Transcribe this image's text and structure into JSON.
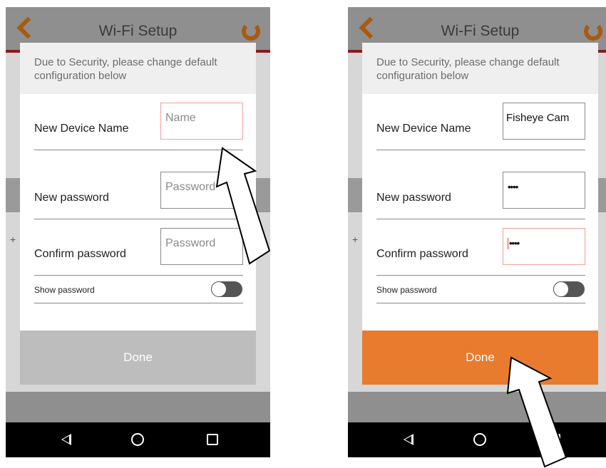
{
  "colors": {
    "accent_orange": "#e87b2e",
    "done_disabled": "#bdbdbd",
    "focus_border": "#f3a09a"
  },
  "screens": [
    {
      "title": "Wi-Fi Setup",
      "message": "Due to Security, please change default configuration below",
      "device_name_label": "New Device Name",
      "device_name_value": "",
      "device_name_placeholder": "Name",
      "password_label": "New password",
      "password_value": "",
      "password_placeholder": "Password",
      "confirm_label": "Confirm password",
      "confirm_value": "",
      "confirm_placeholder": "Password",
      "show_password_label": "Show password",
      "show_password_on": false,
      "done_label": "Done",
      "done_enabled": false
    },
    {
      "title": "Wi-Fi Setup",
      "message": "Due to Security, please change default configuration below",
      "device_name_label": "New Device Name",
      "device_name_value": "Fisheye Cam",
      "password_label": "New password",
      "password_value": "••••",
      "confirm_label": "Confirm password",
      "confirm_value": "••••",
      "show_password_label": "Show password",
      "show_password_on": false,
      "done_label": "Done",
      "done_enabled": true
    }
  ],
  "icons": [
    "back-chevron-icon",
    "refresh-icon",
    "nav-back-icon",
    "nav-home-icon",
    "nav-recents-icon",
    "pointer-arrow-icon"
  ]
}
